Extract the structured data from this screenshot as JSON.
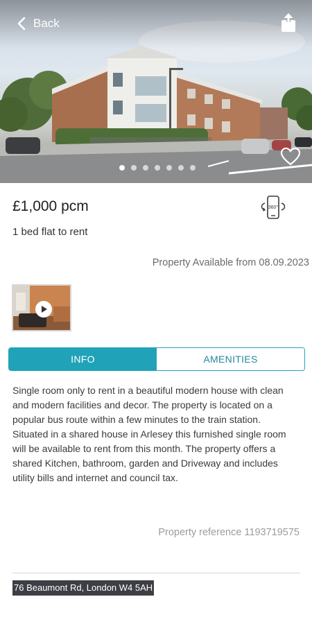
{
  "header": {
    "back_label": "Back",
    "back_icon": "chevron-left-icon",
    "share_icon": "share-icon",
    "favorite_icon": "heart-icon"
  },
  "gallery": {
    "image_count": 7,
    "active_index": 0
  },
  "listing": {
    "price": "£1,000 pcm",
    "title": "1 bed flat to rent",
    "availability": "Property Available from 08.09.2023",
    "virtual_tour_icon": "360-phone-icon",
    "tour_badge": "360°"
  },
  "media": {
    "video_icon": "play-icon"
  },
  "tabs": [
    {
      "label": "INFO",
      "active": true
    },
    {
      "label": "AMENITIES",
      "active": false
    }
  ],
  "description": "Single room only to rent in a beautiful modern house with clean and modern facilities and decor. The property is located on a popular bus route within a few minutes to the train station. Situated in a shared house in Arlesey this furnished single room will be available to rent from this month. The property offers a shared Kitchen, bathroom, garden and Driveway and includes utility bills and internet and council tax.",
  "reference": "Property reference 1193719575",
  "address": "76 Beaumont Rd, London W4 5AH",
  "colors": {
    "accent": "#20a3b9",
    "address_bg": "#3d3f44"
  }
}
